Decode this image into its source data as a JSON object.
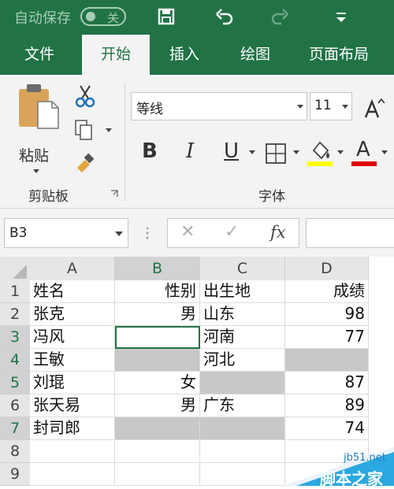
{
  "titlebar": {
    "autosave_label": "自动保存",
    "toggle_state": "关"
  },
  "tabs": [
    {
      "label": "文件"
    },
    {
      "label": "开始"
    },
    {
      "label": "插入"
    },
    {
      "label": "绘图"
    },
    {
      "label": "页面布局"
    }
  ],
  "ribbon": {
    "clipboard": {
      "paste_label": "粘贴",
      "group_label": "剪贴板"
    },
    "font": {
      "font_name": "等线",
      "font_size": "11",
      "bold": "B",
      "italic": "I",
      "underline": "U",
      "font_color_letter": "A",
      "group_label": "字体"
    },
    "colors": {
      "highlight": "#ffff00",
      "font_color": "#e00000"
    }
  },
  "formula_bar": {
    "name_box": "B3",
    "fx": "fx",
    "cancel": "✕",
    "confirm": "✓"
  },
  "sheet": {
    "columns": [
      "A",
      "B",
      "C",
      "D"
    ],
    "rows": [
      "1",
      "2",
      "3",
      "4",
      "5",
      "6",
      "7",
      "8",
      "9"
    ],
    "data": [
      [
        "姓名",
        "性别",
        "出生地",
        "成绩"
      ],
      [
        "张克",
        "男",
        "山东",
        "98"
      ],
      [
        "冯风",
        "",
        "河南",
        "77"
      ],
      [
        "王敏",
        "",
        "河北",
        ""
      ],
      [
        "刘琨",
        "女",
        "",
        "87"
      ],
      [
        "张天易",
        "男",
        "广东",
        "89"
      ],
      [
        "封司郎",
        "",
        "",
        "74"
      ],
      [
        "",
        "",
        "",
        ""
      ],
      [
        "",
        "",
        "",
        ""
      ]
    ]
  },
  "watermark": {
    "site": "jb51.net",
    "brand": "脚本之家"
  }
}
